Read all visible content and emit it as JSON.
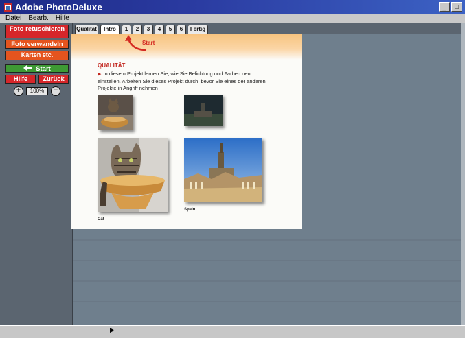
{
  "window": {
    "title": "Adobe PhotoDeluxe",
    "controls": [
      "_",
      "□"
    ]
  },
  "menu": {
    "items": [
      "Datei",
      "Bearb.",
      "Hilfe"
    ]
  },
  "sidebar": {
    "foto_retusch": "Foto retuschieren",
    "foto_verwandeln": "Foto verwandeln",
    "karten": "Karten etc.",
    "start": "Start",
    "hilfe": "Hilfe",
    "zurueck": "Zurück",
    "zoom_value": "100%"
  },
  "tabs": {
    "items": [
      "Qualität",
      "Intro",
      "1",
      "2",
      "3",
      "4",
      "5",
      "6",
      "Fertig"
    ],
    "active_index": 1
  },
  "document": {
    "start_callout": "Start",
    "heading": "QUALITÄT",
    "body": "In diesem Projekt lernen Sie, wie Sie Belichtung und Farben neu einstellen. Arbeiten Sie dieses Projekt durch, bevor Sie eines der anderen Projekte in Angriff nehmen",
    "captions": {
      "cat": "Cat",
      "spain": "Spain"
    }
  },
  "colors": {
    "title_bar": "#1d2a86",
    "accent_red": "#d6262a",
    "accent_orange": "#e5541e",
    "accent_green": "#3e9a34",
    "workspace": "#6f7f8d"
  },
  "icons": [
    "photodeluxe-app-icon",
    "start-arrow-icon",
    "zoom-in-icon",
    "zoom-out-icon",
    "callout-arrow-icon"
  ]
}
